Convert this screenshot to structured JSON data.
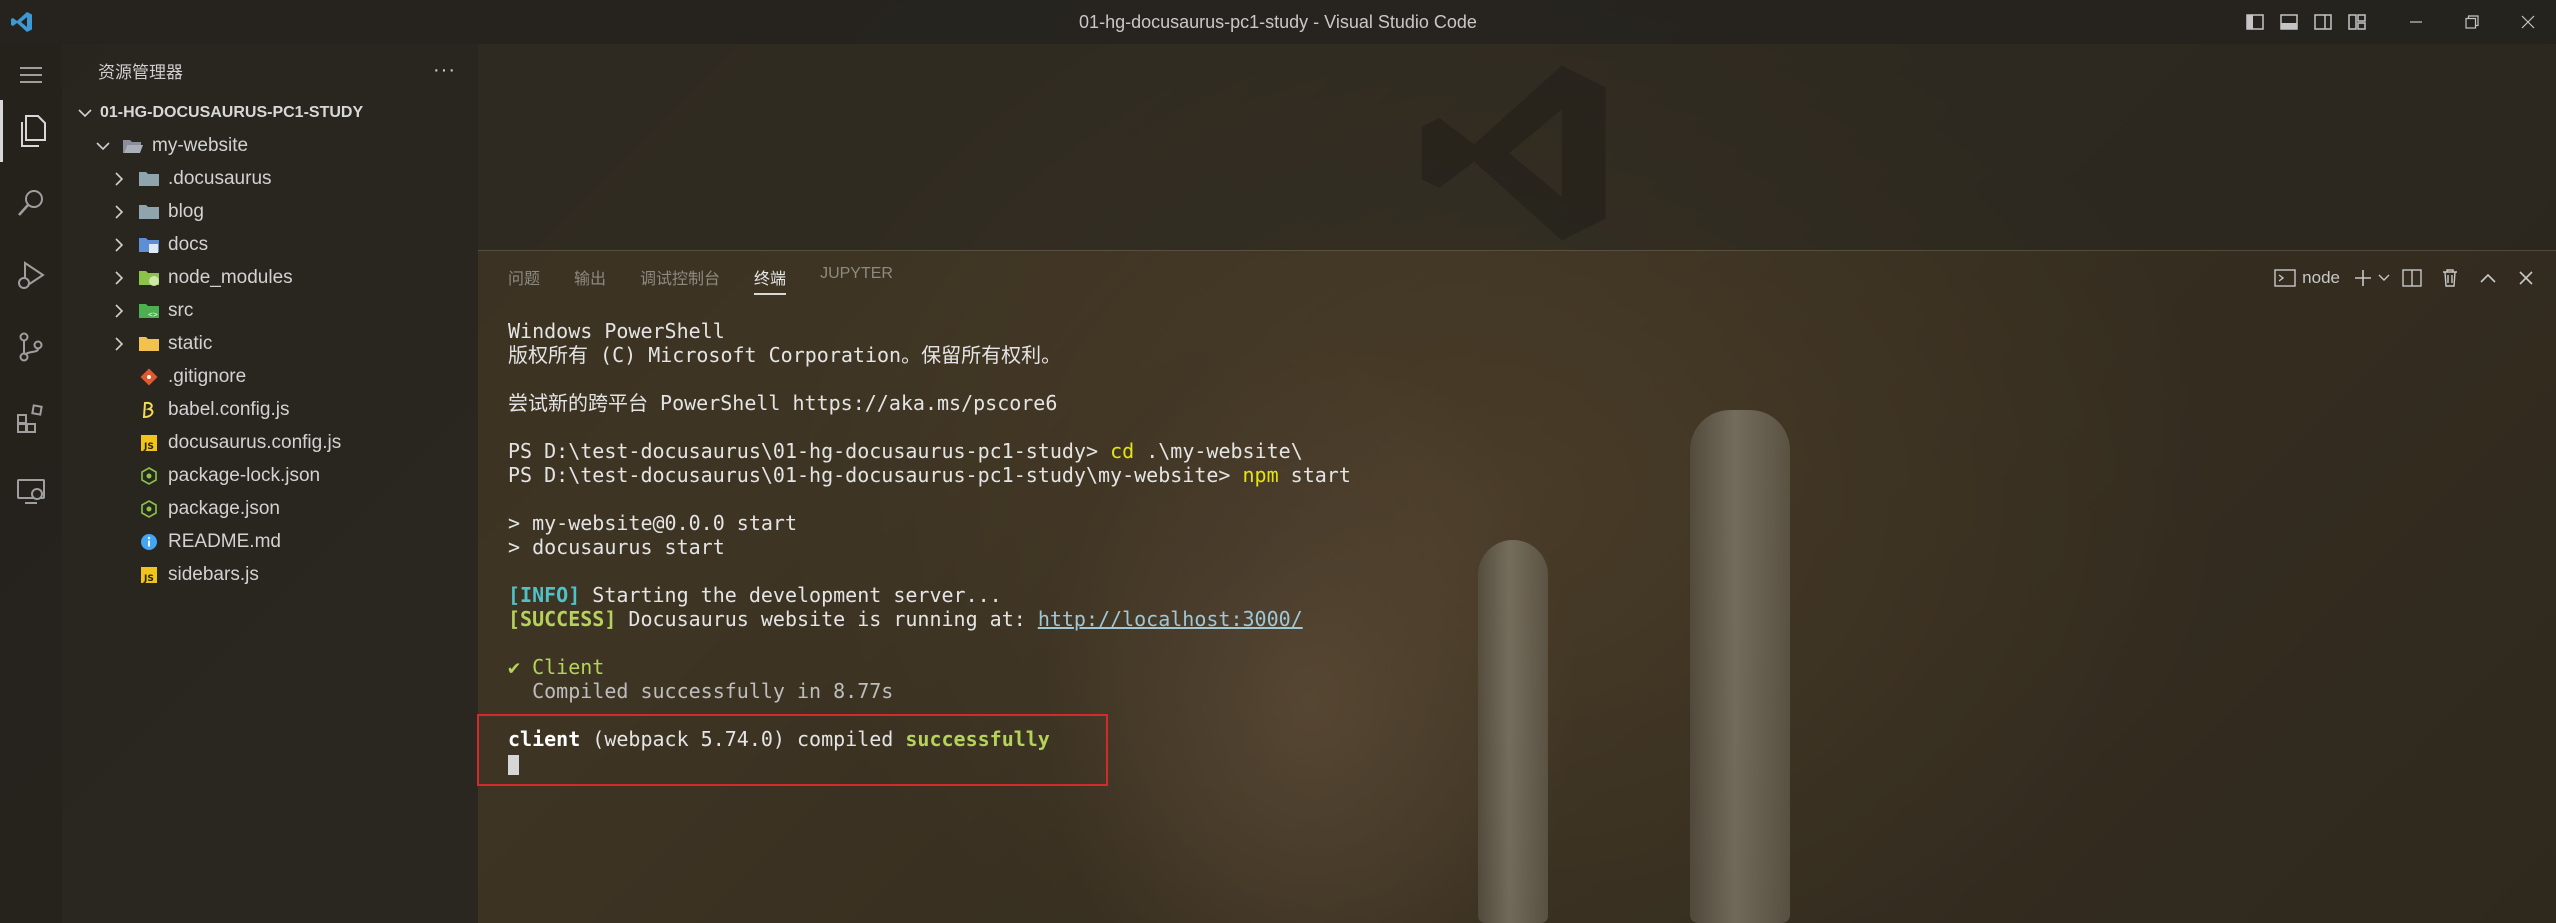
{
  "window": {
    "title": "01-hg-docusaurus-pc1-study - Visual Studio Code"
  },
  "sidebar": {
    "title": "资源管理器",
    "more_label": "···",
    "root_folder": "01-HG-DOCUSAURUS-PC1-STUDY",
    "items": [
      {
        "label": "my-website",
        "icon": "folder-open-icon"
      },
      {
        "label": ".docusaurus",
        "icon": "folder-icon"
      },
      {
        "label": "blog",
        "icon": "folder-icon"
      },
      {
        "label": "docs",
        "icon": "folder-docs-icon"
      },
      {
        "label": "node_modules",
        "icon": "folder-node-icon"
      },
      {
        "label": "src",
        "icon": "folder-src-icon"
      },
      {
        "label": "static",
        "icon": "folder-static-icon"
      },
      {
        "label": ".gitignore",
        "icon": "git-icon"
      },
      {
        "label": "babel.config.js",
        "icon": "babel-icon"
      },
      {
        "label": "docusaurus.config.js",
        "icon": "js-icon"
      },
      {
        "label": "package-lock.json",
        "icon": "npm-json-icon"
      },
      {
        "label": "package.json",
        "icon": "npm-json-icon"
      },
      {
        "label": "README.md",
        "icon": "info-icon"
      },
      {
        "label": "sidebars.js",
        "icon": "js-icon"
      }
    ]
  },
  "panel": {
    "tabs": [
      "问题",
      "输出",
      "调试控制台",
      "终端",
      "JUPYTER"
    ],
    "active_tab": "终端",
    "terminal_name": "node"
  },
  "terminal": {
    "line1": "Windows PowerShell",
    "line2": "版权所有 (C) Microsoft Corporation。保留所有权利。",
    "line3": "尝试新的跨平台 PowerShell https://aka.ms/pscore6",
    "prompt1": "PS D:\\test-docusaurus\\01-hg-docusaurus-pc1-study> ",
    "cmd1_a": "cd",
    "cmd1_b": " .\\my-website\\",
    "prompt2": "PS D:\\test-docusaurus\\01-hg-docusaurus-pc1-study\\my-website> ",
    "cmd2_a": "npm",
    "cmd2_b": " start",
    "script1": "> my-website@0.0.0 start",
    "script2": "> docusaurus start",
    "info_tag": "[INFO]",
    "info_text": " Starting the development server...",
    "success_tag": "[SUCCESS]",
    "success_text": " Docusaurus website is running at: ",
    "url": "http://localhost:3000/",
    "client_label": "✔ Client",
    "compiled_text": "  Compiled successfully in 8.77s",
    "final_a": "client",
    "final_b": " (webpack 5.74.0) compiled ",
    "final_c": "successfully"
  },
  "colors": {
    "highlight_border": "#d42a2a",
    "vscode_blue": "#3c99d4"
  }
}
